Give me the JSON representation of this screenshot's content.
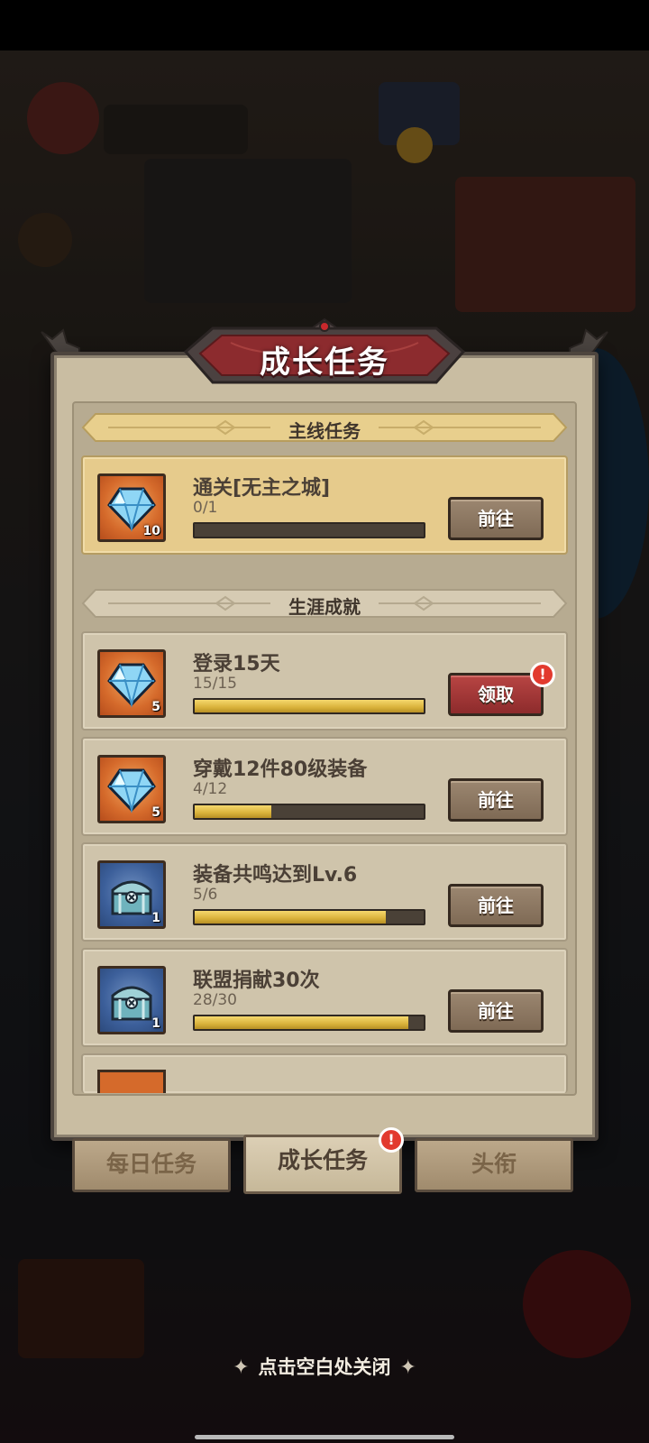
{
  "dialog": {
    "title": "成长任务",
    "close_hint": "点击空白处关闭"
  },
  "sections": {
    "main_title": "主线任务",
    "career_title": "生涯成就"
  },
  "main_task": {
    "title": "通关[无主之城]",
    "progress": "0/1",
    "progress_fraction": 0,
    "reward_icon": "blue-gem-icon",
    "reward_count": "10",
    "button": "前往"
  },
  "career_tasks": [
    {
      "title": "登录15天",
      "progress": "15/15",
      "progress_fraction": 1.0,
      "reward_icon": "blue-gem-icon",
      "reward_count": "5",
      "button": "领取",
      "button_style": "claim",
      "alert": "!"
    },
    {
      "title": "穿戴12件80级装备",
      "progress": "4/12",
      "progress_fraction": 0.333,
      "reward_icon": "blue-gem-icon",
      "reward_count": "5",
      "button": "前往",
      "button_style": "go"
    },
    {
      "title": "装备共鸣达到Lv.6",
      "progress": "5/6",
      "progress_fraction": 0.833,
      "reward_icon": "treasure-chest-icon",
      "reward_count": "1",
      "button": "前往",
      "button_style": "go"
    },
    {
      "title": "联盟捐献30次",
      "progress": "28/30",
      "progress_fraction": 0.933,
      "reward_icon": "treasure-chest-icon",
      "reward_count": "1",
      "button": "前往",
      "button_style": "go"
    }
  ],
  "tabs": [
    {
      "label": "每日任务",
      "active": false
    },
    {
      "label": "成长任务",
      "active": true,
      "alert": "!"
    },
    {
      "label": "头衔",
      "active": false
    }
  ],
  "colors": {
    "panel": "#c9bda2",
    "progress_fill": "#d9b23a",
    "claim_button": "#8d2b2c",
    "go_button": "#7f6a55",
    "alert_badge": "#e23a2e"
  }
}
